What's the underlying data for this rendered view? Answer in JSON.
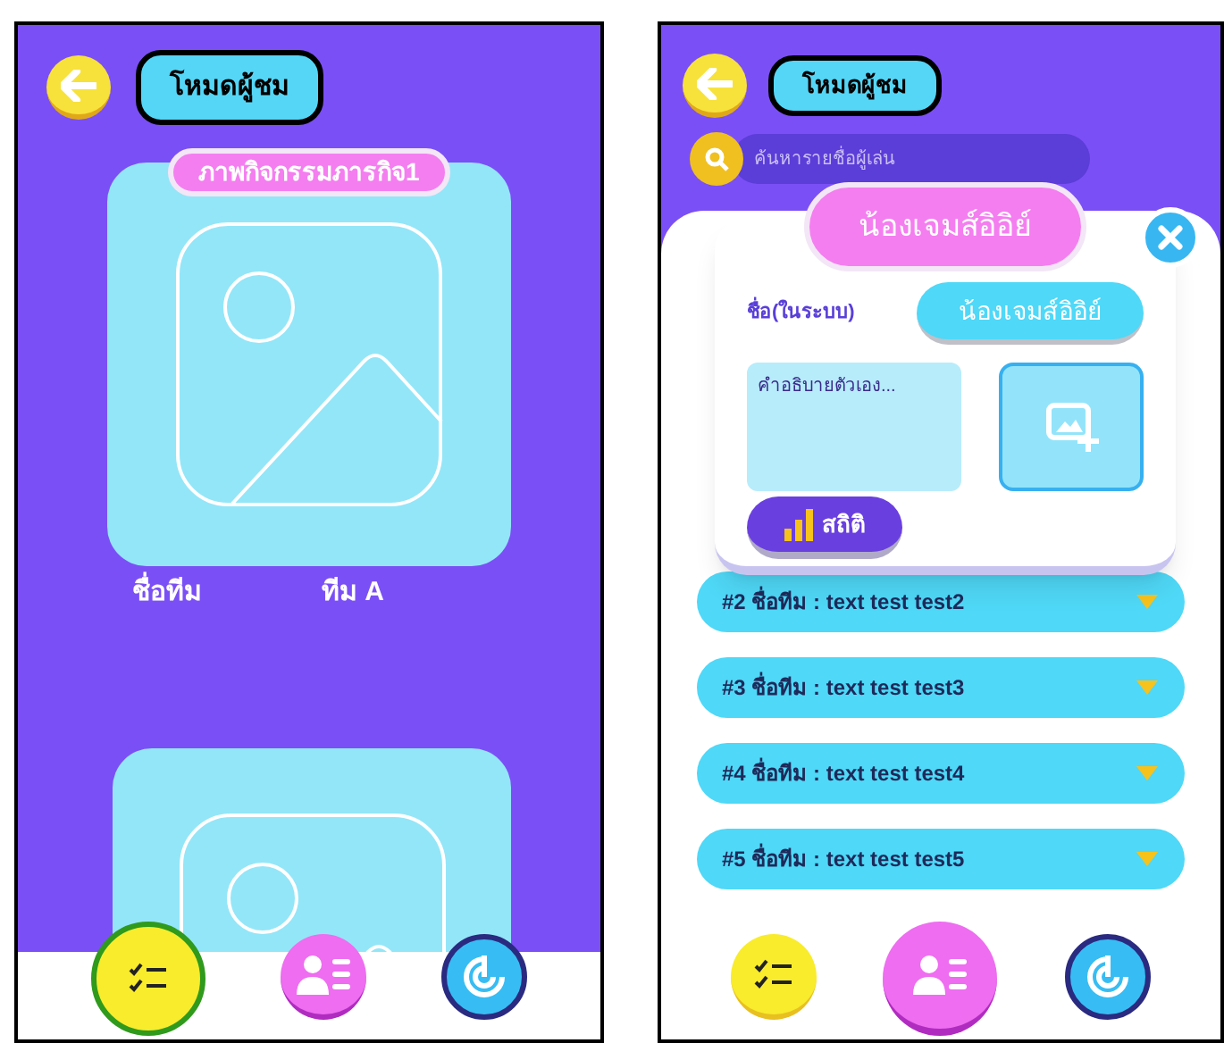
{
  "screens": [
    {
      "kind": "gallery",
      "title": "โหมดผู้ชม",
      "cards": [
        {
          "kind": "full",
          "caption": "ภาพกิจกรรมภารกิจ1",
          "team_label": "ชื่อทีม",
          "team_name": "ทีม A"
        },
        {
          "kind": "partial"
        }
      ],
      "nav": [
        {
          "selected": true
        },
        {
          "selected": false
        },
        {
          "selected": false
        }
      ]
    },
    {
      "kind": "detail",
      "title": "โหมดผู้ชม",
      "search": {
        "placeholder": "ค้นหารายชื่อผู้เล่น"
      },
      "rows": [
        {
          "text": "#2 ชื่อทีม : text test test2"
        },
        {
          "text": "#3 ชื่อทีม : text test test3"
        },
        {
          "text": "#4 ชื่อทีม : text test test4"
        },
        {
          "text": "#5 ชื่อทีม : text test test5"
        }
      ],
      "modal": {
        "title": "น้องเจมส์อิอิย์",
        "name_label": "ชื่อ(ในระบบ)",
        "name_value": "น้องเจมส์อิอิย์",
        "description": {
          "placeholder": "คำอธิบายตัวเอง..."
        },
        "stats_button": "สถิติ"
      },
      "nav": [
        {
          "selected": false
        },
        {
          "selected": true
        },
        {
          "selected": false
        }
      ]
    }
  ]
}
